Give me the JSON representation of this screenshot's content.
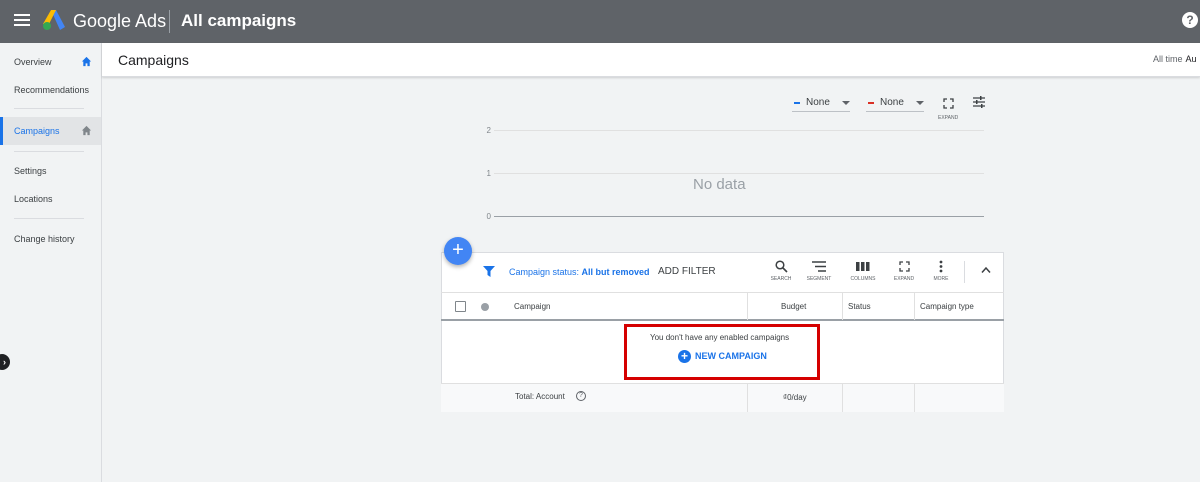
{
  "topbar": {
    "brand": "Google Ads",
    "title": "All campaigns",
    "help_glyph": "?"
  },
  "sidebar": {
    "items": [
      {
        "label": "Overview"
      },
      {
        "label": "Recommendations"
      },
      {
        "label": "Campaigns"
      },
      {
        "label": "Settings"
      },
      {
        "label": "Locations"
      },
      {
        "label": "Change history"
      }
    ],
    "collapse_glyph": "›"
  },
  "header": {
    "title": "Campaigns",
    "range_label": "All time",
    "range_value": "Au"
  },
  "chart": {
    "metric1": {
      "label": "None",
      "color": "#1a73e8"
    },
    "metric2": {
      "label": "None",
      "color": "#d93025"
    },
    "expand_label": "EXPAND",
    "yticks": [
      "2",
      "1",
      "0"
    ],
    "empty_text": "No data"
  },
  "table": {
    "fab_glyph": "+",
    "filter_prefix": "Campaign status: ",
    "filter_value": "All but removed",
    "add_filter": "ADD FILTER",
    "tools": {
      "search": "SEARCH",
      "segment": "SEGMENT",
      "columns": "COLUMNS",
      "expand": "EXPAND",
      "more": "MORE"
    },
    "columns": {
      "campaign": "Campaign",
      "budget": "Budget",
      "status": "Status",
      "type": "Campaign type"
    },
    "empty_message": "You don't have any enabled campaigns",
    "new_campaign": "NEW CAMPAIGN",
    "new_campaign_glyph": "+",
    "total_label": "Total: Account",
    "total_help_glyph": "?",
    "total_budget": "₫0/day"
  }
}
